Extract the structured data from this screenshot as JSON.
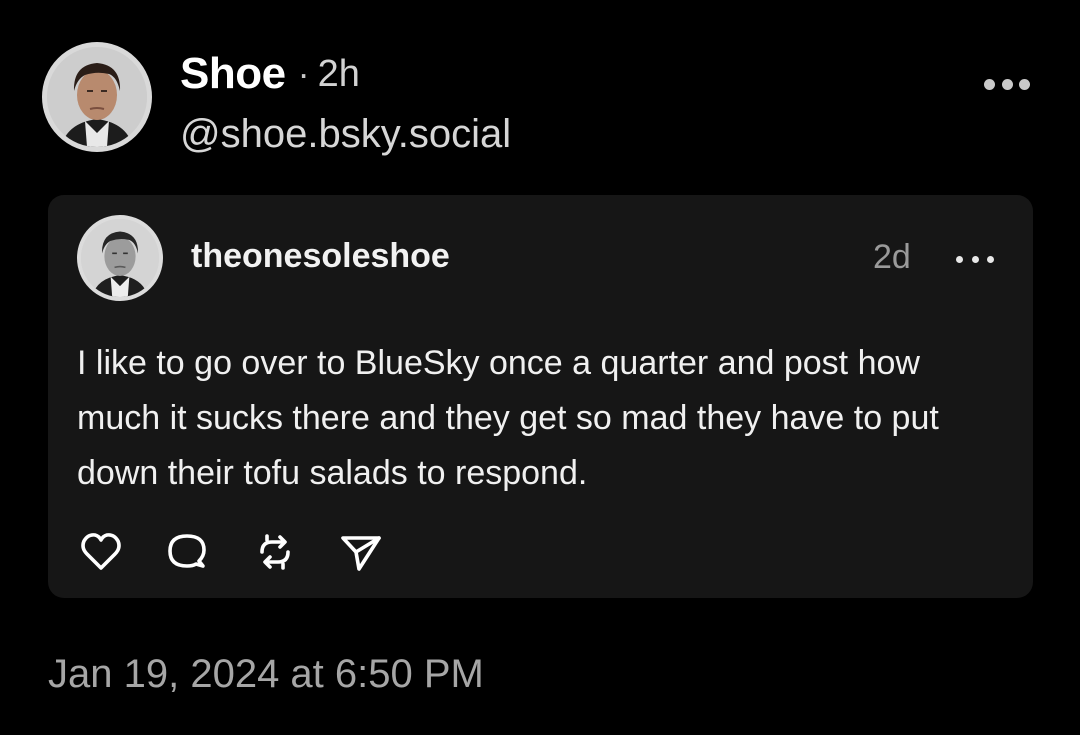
{
  "post": {
    "display_name": "Shoe",
    "separator": "·",
    "time_ago": "2h",
    "handle": "@shoe.bsky.social",
    "more_icon": "more-horizontal-icon",
    "timestamp": "Jan 19, 2024 at 6:50 PM"
  },
  "quote": {
    "username": "theonesoleshoe",
    "time_ago": "2d",
    "more_icon": "more-horizontal-icon",
    "body": "I like to go over to BlueSky once a quarter and post how much it sucks there and they get so mad they have to put down their tofu salads to respond.",
    "actions": {
      "like_icon": "heart-icon",
      "reply_icon": "comment-icon",
      "repost_icon": "repost-icon",
      "share_icon": "send-icon"
    }
  },
  "colors": {
    "background": "#000000",
    "card": "#161616",
    "text_primary": "#ffffff",
    "text_muted": "#a6a6a6"
  }
}
